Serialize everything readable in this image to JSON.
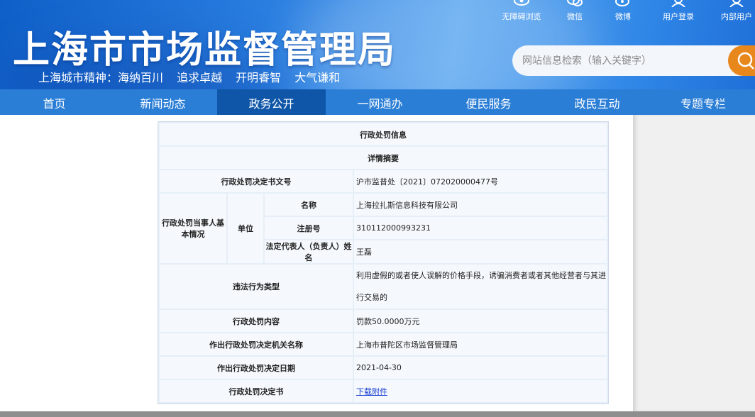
{
  "header": {
    "site_title": "上海市市场监督管理局",
    "slogan": "上海城市精神：海纳百川  追求卓越  开明睿智  大气谦和",
    "top_links": [
      {
        "label": "无障碍浏览",
        "icon": "eye-icon"
      },
      {
        "label": "微信",
        "icon": "wechat-icon"
      },
      {
        "label": "微博",
        "icon": "weibo-icon"
      },
      {
        "label": "用户登录",
        "icon": "user-icon"
      },
      {
        "label": "内部用户",
        "icon": "user-icon"
      }
    ],
    "search": {
      "placeholder": "网站信息检索（输入关键字）",
      "button_icon": "search-icon",
      "button_color": "#e8871c"
    }
  },
  "nav": {
    "items": [
      "首页",
      "新闻动态",
      "政务公开",
      "一网通办",
      "便民服务",
      "政民互动",
      "专题专栏"
    ],
    "active": "政务公开"
  },
  "detail": {
    "title": "行政处罚信息",
    "subtitle": "详情摘要",
    "doc_no_label": "行政处罚决定书文号",
    "doc_no": "沪市监普处〔2021〕072020000477号",
    "party_label": "行政处罚当事人基本情况",
    "unit_label": "单位",
    "name_label": "名称",
    "name": "上海拉扎斯信息科技有限公司",
    "reg_no_label": "注册号",
    "reg_no": "310112000993231",
    "legal_rep_label": "法定代表人（负责人）姓名",
    "legal_rep": "王磊",
    "violation_label": "违法行为类型",
    "violation": "利用虚假的或者使人误解的价格手段，诱骗消费者或者其他经营者与其进行交易的",
    "penalty_label": "行政处罚内容",
    "penalty": "罚款50.0000万元",
    "authority_label": "作出行政处罚决定机关名称",
    "authority": "上海市普陀区市场监督管理局",
    "date_label": "作出行政处罚决定日期",
    "date": "2021-04-30",
    "decision_label": "行政处罚决定书",
    "decision_link": "下载附件"
  },
  "colors": {
    "nav_bg": "#2b7ed6",
    "nav_active": "#0f56a8",
    "link": "#1b3fd1"
  }
}
